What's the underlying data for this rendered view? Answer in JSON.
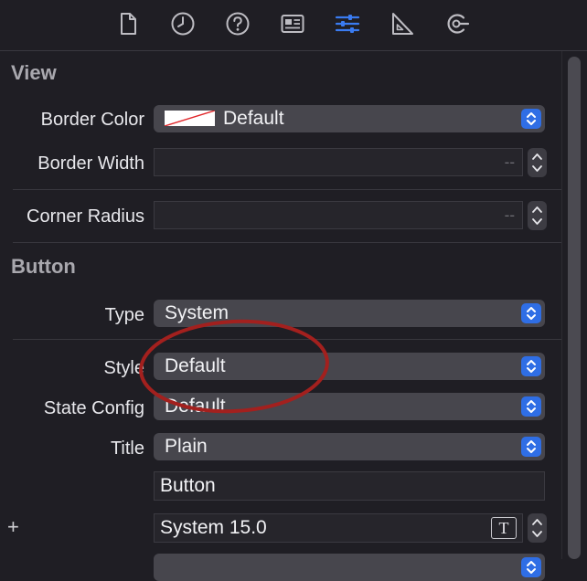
{
  "toolbar": {
    "tabs": [
      {
        "icon": "file-icon",
        "active": false
      },
      {
        "icon": "clock-icon",
        "active": false
      },
      {
        "icon": "help-icon",
        "active": false
      },
      {
        "icon": "identity-icon",
        "active": false
      },
      {
        "icon": "sliders-icon",
        "active": true
      },
      {
        "icon": "ruler-icon",
        "active": false
      },
      {
        "icon": "connections-icon",
        "active": false
      }
    ],
    "accent": "#3a7bf0"
  },
  "view": {
    "title": "View",
    "border_color": {
      "label": "Border Color",
      "value": "Default"
    },
    "border_width": {
      "label": "Border Width",
      "placeholder": "--"
    },
    "corner_radius": {
      "label": "Corner Radius",
      "placeholder": "--"
    }
  },
  "button": {
    "title": "Button",
    "type": {
      "label": "Type",
      "value": "System"
    },
    "style": {
      "label": "Style",
      "value": "Default"
    },
    "state_config": {
      "label": "State Config",
      "value": "Default"
    },
    "title_row": {
      "label": "Title",
      "value": "Plain"
    },
    "title_text": "Button",
    "font": {
      "value": "System 15.0",
      "plus": "+"
    }
  },
  "annotation_color": "#a3201e"
}
